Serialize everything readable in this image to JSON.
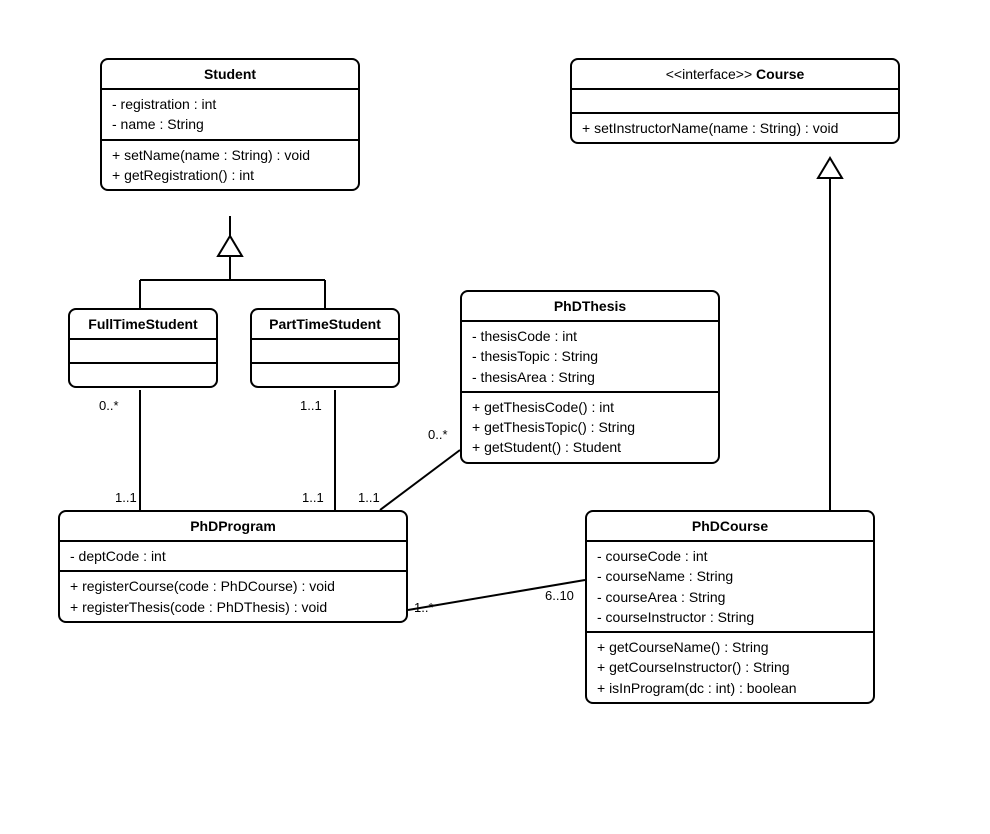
{
  "classes": {
    "student": {
      "name": "Student",
      "attrs": [
        "- registration : int",
        "- name : String"
      ],
      "ops": [
        "+ setName(name : String) : void",
        "+ getRegistration() : int"
      ]
    },
    "course": {
      "stereotype": "<<interface>>",
      "name": "Course",
      "attrs": [],
      "ops": [
        "+ setInstructorName(name : String) : void"
      ]
    },
    "fulltime": {
      "name": "FullTimeStudent",
      "attrs": [],
      "ops": []
    },
    "parttime": {
      "name": "PartTimeStudent",
      "attrs": [],
      "ops": []
    },
    "thesis": {
      "name": "PhDThesis",
      "attrs": [
        "- thesisCode : int",
        "- thesisTopic : String",
        "- thesisArea : String"
      ],
      "ops": [
        "+ getThesisCode() : int",
        "+ getThesisTopic() : String",
        "+ getStudent() : Student"
      ]
    },
    "program": {
      "name": "PhDProgram",
      "attrs": [
        "- deptCode : int"
      ],
      "ops": [
        "+ registerCourse(code : PhDCourse) : void",
        "+ registerThesis(code : PhDThesis) : void"
      ]
    },
    "phdcourse": {
      "name": "PhDCourse",
      "attrs": [
        "- courseCode : int",
        "- courseName : String",
        "- courseArea : String",
        "- courseInstructor : String"
      ],
      "ops": [
        "+ getCourseName() : String",
        "+ getCourseInstructor() : String",
        "+ isInProgram(dc : int) : boolean"
      ]
    }
  },
  "mult": {
    "ft_top": "0..*",
    "ft_bot": "1..1",
    "pt_top": "1..1",
    "pt_bot": "1..1",
    "thesis_l": "0..*",
    "thesis_b": "1..1",
    "prog_r1": "1..*",
    "course_l": "6..10"
  }
}
